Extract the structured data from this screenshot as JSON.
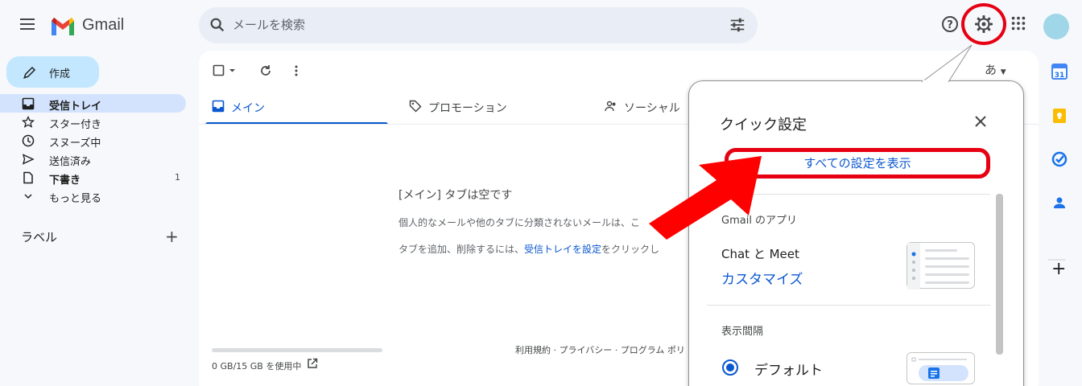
{
  "header": {
    "brand": "Gmail",
    "search_placeholder": "メールを検索"
  },
  "nav": {
    "compose_label": "作成",
    "items": [
      {
        "label": "受信トレイ",
        "icon": "inbox-icon",
        "bold": true,
        "active": true,
        "count": ""
      },
      {
        "label": "スター付き",
        "icon": "star-icon",
        "bold": false,
        "active": false,
        "count": ""
      },
      {
        "label": "スヌーズ中",
        "icon": "clock-icon",
        "bold": false,
        "active": false,
        "count": ""
      },
      {
        "label": "送信済み",
        "icon": "send-icon",
        "bold": false,
        "active": false,
        "count": ""
      },
      {
        "label": "下書き",
        "icon": "draft-icon",
        "bold": true,
        "active": false,
        "count": "1"
      },
      {
        "label": "もっと見る",
        "icon": "chevron-down-icon",
        "bold": false,
        "active": false,
        "count": ""
      }
    ],
    "labels_heading": "ラベル",
    "labels_add": "+"
  },
  "toolbar": {
    "input_tool": "あ"
  },
  "tabs": [
    {
      "label": "メイン",
      "icon": "inbox-icon"
    },
    {
      "label": "プロモーション",
      "icon": "tag-icon"
    },
    {
      "label": "ソーシャル",
      "icon": "people-icon"
    }
  ],
  "empty": {
    "title": "[メイン] タブは空です",
    "line1": "個人的なメールや他のタブに分類されないメールは、こ",
    "line2_pre": "タブを追加、削除するには、",
    "line2_link": "受信トレイを設定",
    "line2_post": "をクリックし"
  },
  "storage": {
    "text": "0 GB/15 GB を使用中",
    "used_fraction": 0.0
  },
  "footer": {
    "text": "利用規約 · プライバシー · プログラム ポリ"
  },
  "quick_settings": {
    "title": "クイック設定",
    "close": "✕",
    "all_settings": "すべての設定を表示",
    "apps_heading": "Gmail のアプリ",
    "chat_meet": "Chat と Meet",
    "customize": "カスタマイズ",
    "density_heading": "表示間隔",
    "density_default": "デフォルト"
  },
  "side_panel": {
    "calendar_badge": "31",
    "add": "+"
  },
  "colors": {
    "highlight": "#e60012",
    "accent": "#0b57d0",
    "compose_bg": "#c2e7ff",
    "active_nav": "#d3e3fd"
  }
}
